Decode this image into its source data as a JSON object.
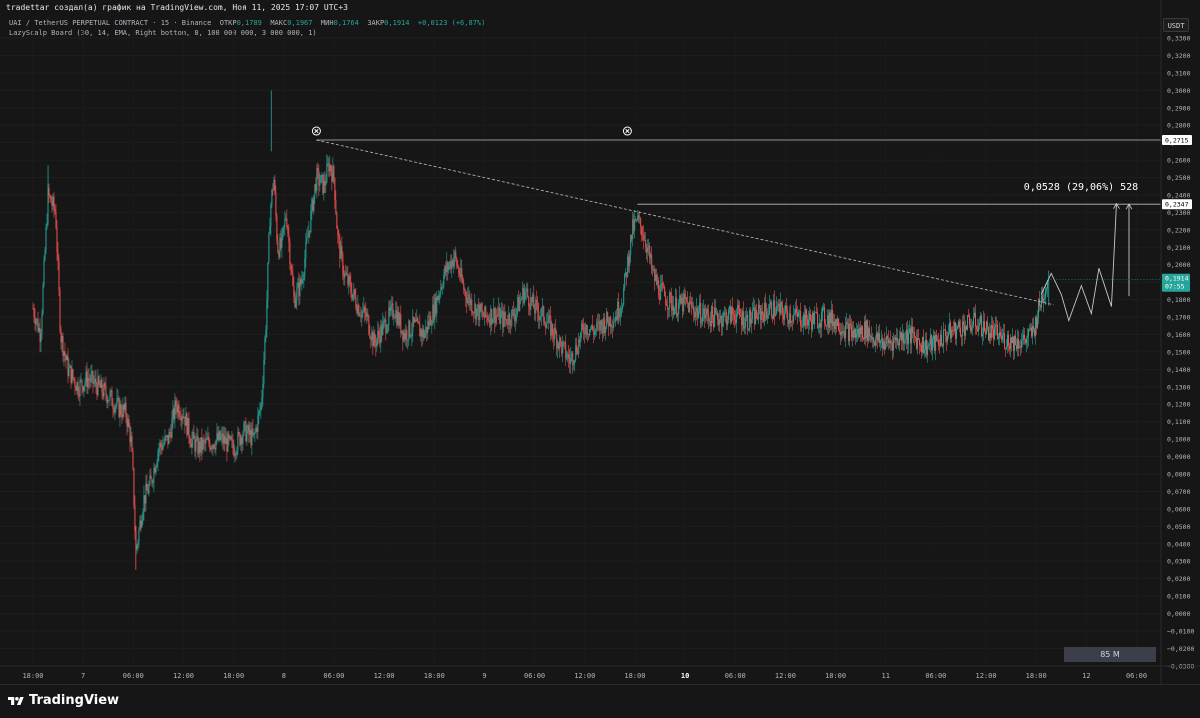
{
  "caption": "tradettar создал(а) график на TradingView.com, Ноя 11, 2025 17:07 UTC+3",
  "legend": {
    "symbol": "UAI / TetherUS PERPETUAL CONTRACT · 15 · Binance",
    "open_label": "ОТКР",
    "open_value": "0,1789",
    "high_label": "МАКС",
    "high_value": "0,1967",
    "low_label": "МИН",
    "low_value": "0,1764",
    "close_label": "ЗАКР",
    "close_value": "0,1914",
    "change": "+0,0123 (+6,87%)",
    "indicator": "LazyScalp Board (30, 14, EMA, Right bottom, 8, 100 000 000, 3 000 000, 1)"
  },
  "currency": "USDT",
  "volume_badge": "85 M",
  "footer_brand": "TradingView",
  "colors": {
    "up": "#26a69a",
    "down": "#ef5350",
    "background": "#161616",
    "current_price_bg": "#26a69a",
    "line_label_bg": "#ffffff"
  },
  "chart_data": {
    "type": "candlestick",
    "symbol": "UAI / TetherUS PERPETUAL CONTRACT",
    "interval": "15",
    "exchange": "Binance",
    "y_axis": {
      "range": [
        -0.03,
        0.34
      ],
      "tick_step": 0.01,
      "tick_labels": [
        "0,3300",
        "0,3200",
        "0,3100",
        "0,3000",
        "0,2900",
        "0,2800",
        "0,2700",
        "0,2600",
        "0,2500",
        "0,2400",
        "0,2300",
        "0,2200",
        "0,2100",
        "0,2000",
        "0,1900",
        "0,1800",
        "0,1700",
        "0,1600",
        "0,1500",
        "0,1400",
        "0,1300",
        "0,1200",
        "0,1100",
        "0,1000",
        "0,0900",
        "0,0800",
        "0,0700",
        "0,0600",
        "0,0500",
        "0,0400",
        "0,0300",
        "0,0200",
        "0,0100",
        "0,0000",
        "−0,0100",
        "−0,0200",
        "−0,0300"
      ]
    },
    "x_axis": {
      "tick_labels": [
        {
          "label": "18:00",
          "t": 1
        },
        {
          "label": "7",
          "t": 3,
          "day": true
        },
        {
          "label": "06:00",
          "t": 5
        },
        {
          "label": "12:00",
          "t": 7
        },
        {
          "label": "18:00",
          "t": 9
        },
        {
          "label": "8",
          "t": 11,
          "day": true
        },
        {
          "label": "06:00",
          "t": 13
        },
        {
          "label": "12:00",
          "t": 15
        },
        {
          "label": "18:00",
          "t": 17
        },
        {
          "label": "9",
          "t": 19,
          "day": true
        },
        {
          "label": "06:00",
          "t": 21
        },
        {
          "label": "12:00",
          "t": 23
        },
        {
          "label": "18:00",
          "t": 25
        },
        {
          "label": "10",
          "t": 27,
          "day": true,
          "bold": true
        },
        {
          "label": "06:00",
          "t": 29
        },
        {
          "label": "12:00",
          "t": 31
        },
        {
          "label": "18:00",
          "t": 33
        },
        {
          "label": "11",
          "t": 35,
          "day": true
        },
        {
          "label": "06:00",
          "t": 37
        },
        {
          "label": "12:00",
          "t": 39
        },
        {
          "label": "18:00",
          "t": 41
        },
        {
          "label": "12",
          "t": 43,
          "day": true
        },
        {
          "label": "06:00",
          "t": 45
        }
      ]
    },
    "price_path": [
      [
        0.0,
        0.175
      ],
      [
        0.3,
        0.16
      ],
      [
        0.6,
        0.24
      ],
      [
        0.9,
        0.23
      ],
      [
        1.1,
        0.16
      ],
      [
        1.4,
        0.14
      ],
      [
        1.8,
        0.13
      ],
      [
        2.2,
        0.135
      ],
      [
        2.6,
        0.13
      ],
      [
        3.0,
        0.125
      ],
      [
        3.4,
        0.118
      ],
      [
        3.7,
        0.115
      ],
      [
        3.9,
        0.1
      ],
      [
        4.0,
        0.075
      ],
      [
        4.1,
        0.035
      ],
      [
        4.2,
        0.045
      ],
      [
        4.4,
        0.065
      ],
      [
        4.7,
        0.075
      ],
      [
        5.0,
        0.095
      ],
      [
        5.4,
        0.1
      ],
      [
        5.7,
        0.12
      ],
      [
        6.0,
        0.115
      ],
      [
        6.3,
        0.1
      ],
      [
        6.6,
        0.095
      ],
      [
        7.0,
        0.098
      ],
      [
        7.5,
        0.1
      ],
      [
        8.0,
        0.095
      ],
      [
        8.4,
        0.105
      ],
      [
        8.8,
        0.1
      ],
      [
        9.1,
        0.12
      ],
      [
        9.3,
        0.17
      ],
      [
        9.45,
        0.23
      ],
      [
        9.6,
        0.25
      ],
      [
        9.75,
        0.21
      ],
      [
        9.9,
        0.21
      ],
      [
        10.1,
        0.23
      ],
      [
        10.4,
        0.18
      ],
      [
        10.7,
        0.19
      ],
      [
        11.0,
        0.22
      ],
      [
        11.3,
        0.25
      ],
      [
        11.6,
        0.245
      ],
      [
        11.8,
        0.258
      ],
      [
        12.0,
        0.25
      ],
      [
        12.15,
        0.215
      ],
      [
        12.4,
        0.195
      ],
      [
        12.7,
        0.185
      ],
      [
        13.0,
        0.175
      ],
      [
        13.3,
        0.17
      ],
      [
        13.6,
        0.155
      ],
      [
        14.0,
        0.165
      ],
      [
        14.4,
        0.175
      ],
      [
        14.8,
        0.16
      ],
      [
        15.2,
        0.165
      ],
      [
        15.6,
        0.16
      ],
      [
        16.0,
        0.175
      ],
      [
        16.4,
        0.195
      ],
      [
        16.8,
        0.205
      ],
      [
        17.2,
        0.185
      ],
      [
        17.6,
        0.175
      ],
      [
        18.0,
        0.17
      ],
      [
        18.4,
        0.172
      ],
      [
        18.8,
        0.168
      ],
      [
        19.2,
        0.172
      ],
      [
        19.6,
        0.185
      ],
      [
        20.0,
        0.175
      ],
      [
        20.4,
        0.17
      ],
      [
        20.8,
        0.16
      ],
      [
        21.2,
        0.15
      ],
      [
        21.4,
        0.145
      ],
      [
        21.6,
        0.15
      ],
      [
        22.0,
        0.165
      ],
      [
        22.4,
        0.162
      ],
      [
        22.8,
        0.167
      ],
      [
        23.2,
        0.17
      ],
      [
        23.5,
        0.18
      ],
      [
        23.7,
        0.2
      ],
      [
        23.9,
        0.22
      ],
      [
        24.1,
        0.225
      ],
      [
        24.3,
        0.22
      ],
      [
        24.5,
        0.21
      ],
      [
        24.7,
        0.195
      ],
      [
        25.0,
        0.185
      ],
      [
        25.3,
        0.18
      ],
      [
        25.6,
        0.176
      ],
      [
        26.0,
        0.178
      ],
      [
        26.5,
        0.173
      ],
      [
        27.0,
        0.17
      ],
      [
        27.5,
        0.17
      ],
      [
        28.0,
        0.172
      ],
      [
        28.5,
        0.168
      ],
      [
        29.0,
        0.172
      ],
      [
        29.5,
        0.175
      ],
      [
        30.0,
        0.172
      ],
      [
        30.5,
        0.17
      ],
      [
        31.0,
        0.168
      ],
      [
        31.5,
        0.17
      ],
      [
        32.0,
        0.168
      ],
      [
        32.4,
        0.163
      ],
      [
        32.8,
        0.16
      ],
      [
        33.2,
        0.163
      ],
      [
        33.6,
        0.157
      ],
      [
        34.0,
        0.155
      ],
      [
        34.4,
        0.157
      ],
      [
        34.8,
        0.16
      ],
      [
        35.2,
        0.158
      ],
      [
        35.6,
        0.153
      ],
      [
        36.0,
        0.155
      ],
      [
        36.4,
        0.16
      ],
      [
        36.8,
        0.163
      ],
      [
        37.2,
        0.165
      ],
      [
        37.6,
        0.167
      ],
      [
        38.0,
        0.163
      ],
      [
        38.4,
        0.16
      ],
      [
        38.8,
        0.157
      ],
      [
        39.2,
        0.156
      ],
      [
        39.6,
        0.157
      ],
      [
        39.9,
        0.162
      ],
      [
        40.1,
        0.175
      ],
      [
        40.3,
        0.185
      ],
      [
        40.45,
        0.19
      ]
    ],
    "current_price": {
      "value": "0,1914",
      "countdown": "07:55",
      "price": 0.1914
    },
    "horizontal_lines": [
      {
        "price": 0.2715,
        "label": "0,2715"
      },
      {
        "price": 0.2347,
        "label": "0,2347"
      }
    ],
    "trend_line": {
      "from": [
        11.3,
        0.2715
      ],
      "to": [
        40.7,
        0.177
      ]
    },
    "projection_path": [
      [
        40.2,
        0.183
      ],
      [
        40.6,
        0.195
      ],
      [
        41.0,
        0.183
      ],
      [
        41.3,
        0.168
      ],
      [
        41.8,
        0.188
      ],
      [
        42.2,
        0.172
      ],
      [
        42.5,
        0.198
      ],
      [
        43.0,
        0.176
      ],
      [
        43.2,
        0.235
      ]
    ],
    "measure": {
      "label": "0,0528 (29,06%) 528",
      "from_price": 0.182,
      "to_price": 0.2347,
      "t": 43.7
    }
  }
}
